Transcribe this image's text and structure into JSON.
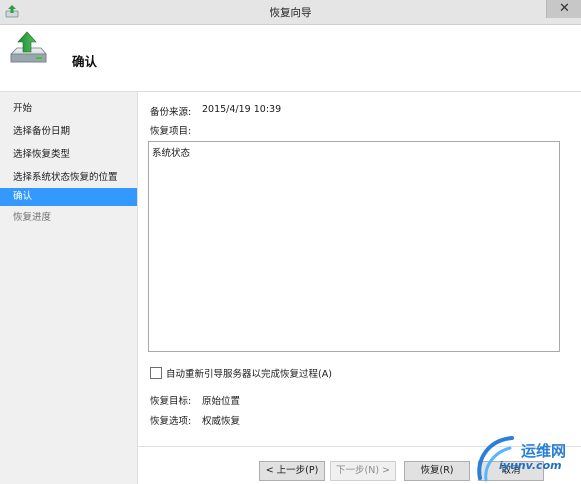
{
  "window": {
    "title": "恢复向导",
    "close_glyph": "✕"
  },
  "header": {
    "title": "确认",
    "icon": "restore-drive-icon"
  },
  "sidebar": {
    "items": [
      {
        "label": "开始",
        "state": "normal"
      },
      {
        "label": "选择备份日期",
        "state": "normal"
      },
      {
        "label": "选择恢复类型",
        "state": "normal"
      },
      {
        "label": "选择系统状态恢复的位置",
        "state": "normal"
      },
      {
        "label": "确认",
        "state": "selected"
      },
      {
        "label": "恢复进度",
        "state": "disabled"
      }
    ]
  },
  "main": {
    "backup_source_label": "备份来源:",
    "backup_source_value": "2015/4/19 10:39",
    "recovery_items_label": "恢复项目:",
    "recovery_items": [
      "系统状态"
    ],
    "reboot_checkbox": {
      "label": "自动重新引导服务器以完成恢复过程(A)",
      "checked": false
    },
    "recovery_target_label": "恢复目标:",
    "recovery_target_value": "原始位置",
    "recovery_option_label": "恢复选项:",
    "recovery_option_value": "权威恢复"
  },
  "buttons": {
    "prev": "< 上一步(P)",
    "next": "下一步(N) >",
    "recover": "恢复(R)",
    "cancel": "取消"
  },
  "watermark": {
    "brand": "运维网",
    "url": "iyunv.com"
  },
  "colors": {
    "selected": "#3399ff",
    "sidebar_bg": "#f0f0f0",
    "titlebar_bg": "#e5e5e5"
  }
}
